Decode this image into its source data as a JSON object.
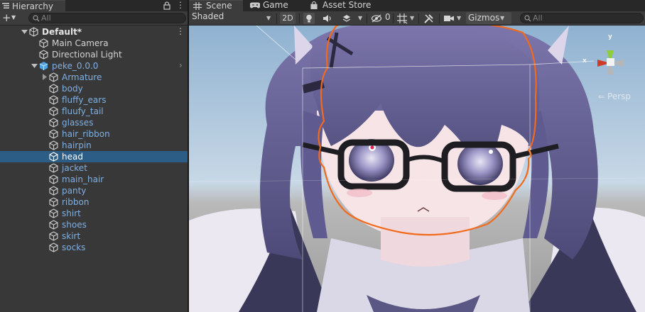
{
  "hierarchy": {
    "tab_title": "Hierarchy",
    "search_placeholder": "All",
    "icons": [
      "hierarchy-list-icon",
      "lock-icon",
      "kebab-menu-icon",
      "plus-icon",
      "search-icon"
    ],
    "rows": [
      {
        "label": "Default*",
        "type": "scene",
        "expanded": true,
        "selected": false
      },
      {
        "label": "Main Camera",
        "type": "gameobject",
        "selected": false
      },
      {
        "label": "Directional Light",
        "type": "gameobject",
        "selected": false
      },
      {
        "label": "peke_0.0.0",
        "type": "prefab",
        "expanded": true,
        "selected": false
      },
      {
        "label": "Armature",
        "type": "prefab-child",
        "collapsed": true,
        "selected": false
      },
      {
        "label": "body",
        "type": "prefab-child",
        "selected": false
      },
      {
        "label": "fluffy_ears",
        "type": "prefab-child",
        "selected": false
      },
      {
        "label": "fluufy_tail",
        "type": "prefab-child",
        "selected": false
      },
      {
        "label": "glasses",
        "type": "prefab-child",
        "selected": false
      },
      {
        "label": "hair_ribbon",
        "type": "prefab-child",
        "selected": false
      },
      {
        "label": "hairpin",
        "type": "prefab-child",
        "selected": false
      },
      {
        "label": "head",
        "type": "prefab-child",
        "selected": true
      },
      {
        "label": "jacket",
        "type": "prefab-child",
        "selected": false
      },
      {
        "label": "main_hair",
        "type": "prefab-child",
        "selected": false
      },
      {
        "label": "panty",
        "type": "prefab-child",
        "selected": false
      },
      {
        "label": "ribbon",
        "type": "prefab-child",
        "selected": false
      },
      {
        "label": "shirt",
        "type": "prefab-child",
        "selected": false
      },
      {
        "label": "shoes",
        "type": "prefab-child",
        "selected": false
      },
      {
        "label": "skirt",
        "type": "prefab-child",
        "selected": false
      },
      {
        "label": "socks",
        "type": "prefab-child",
        "selected": false
      }
    ]
  },
  "scene_tabs": [
    {
      "label": "Scene",
      "icon": "grid-icon",
      "active": true
    },
    {
      "label": "Game",
      "icon": "gamepad-icon",
      "active": false
    },
    {
      "label": "Asset Store",
      "icon": "shopping-bag-icon",
      "active": false
    }
  ],
  "scene_toolbar": {
    "shading_mode": "Shaded",
    "mode_2d": "2D",
    "hidden_count": "0",
    "gizmos_label": "Gizmos",
    "search_placeholder": "All",
    "icons": [
      "lighting-icon",
      "audio-icon",
      "effects-icon",
      "hidden-objects-icon",
      "grid-toggle-icon",
      "tools-icon",
      "camera-icon"
    ]
  },
  "scene_gizmo": {
    "projection_label": "Persp",
    "axis_y": "y",
    "axis_x": "x"
  },
  "colors": {
    "selection": "#2c5d87",
    "prefab_text": "#7fb0e4",
    "outline_orange": "#f26a1b",
    "panel_bg": "#383838",
    "sky_top": "#8fb2d1"
  }
}
